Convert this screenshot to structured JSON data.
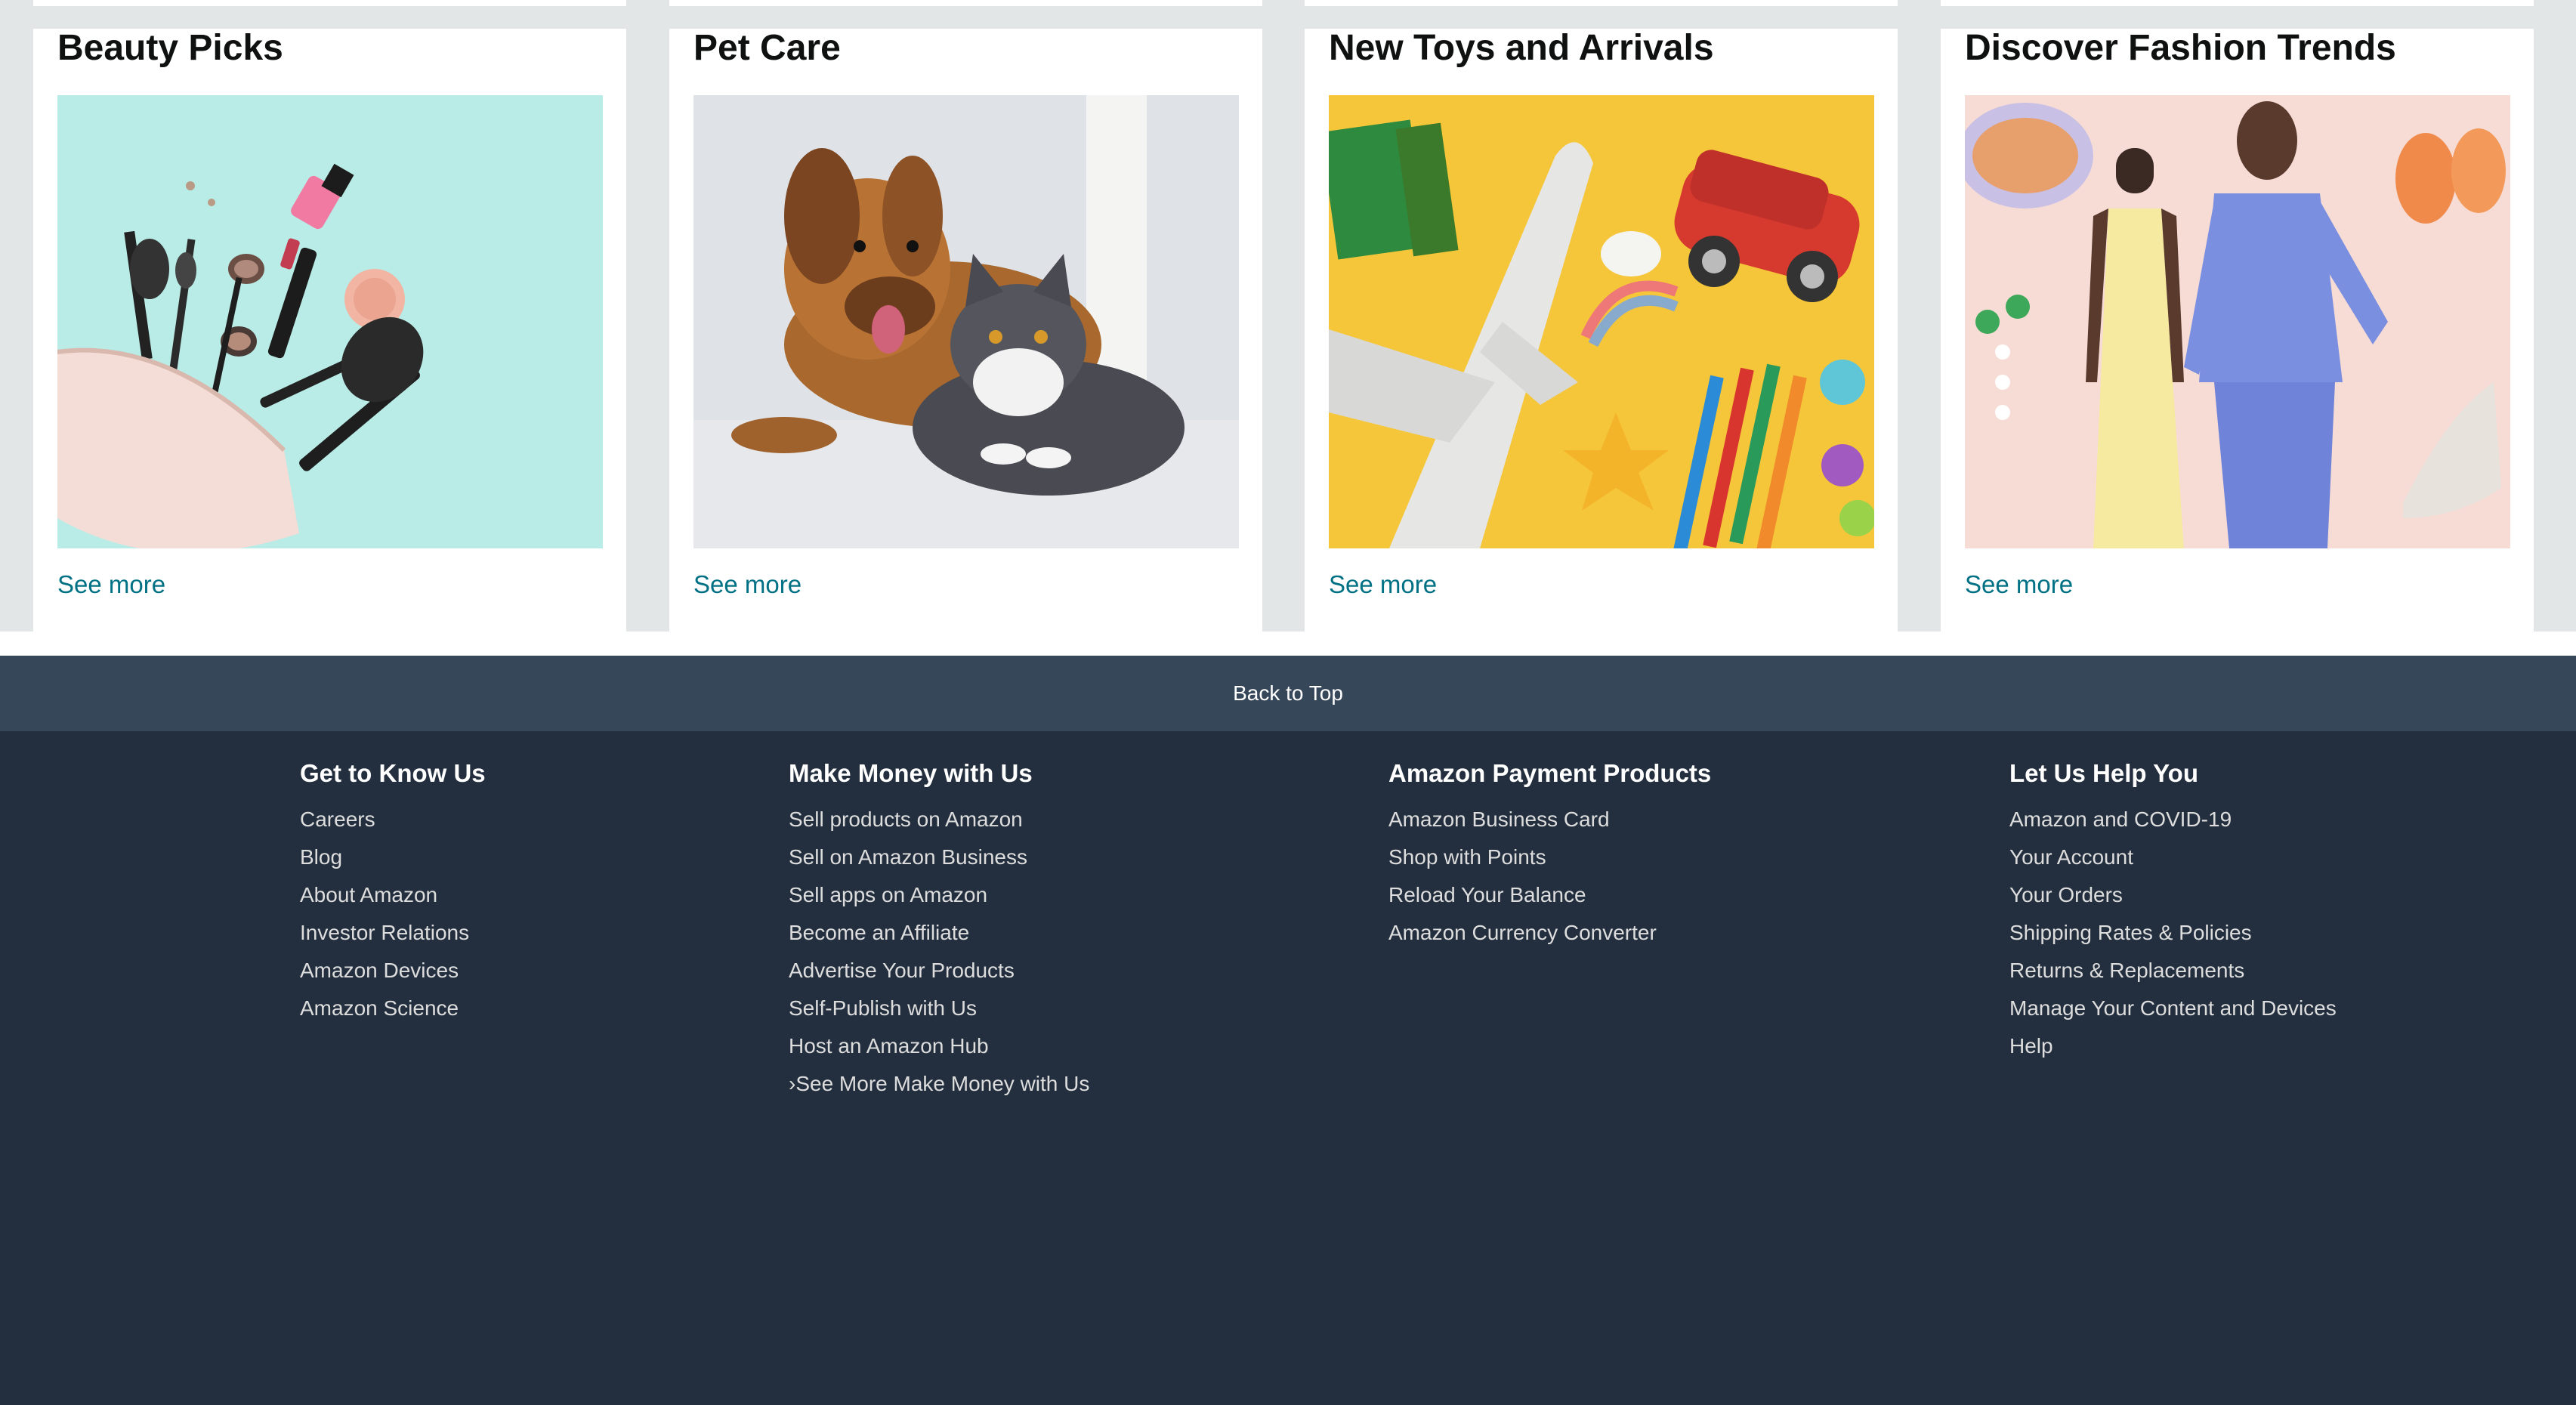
{
  "cards": [
    {
      "title": "Beauty Picks",
      "link": "See more",
      "image": "makeup-bag-image"
    },
    {
      "title": "Pet Care",
      "link": "See more",
      "image": "dog-and-cat-image"
    },
    {
      "title": "New Toys and Arrivals",
      "link": "See more",
      "image": "toys-image"
    },
    {
      "title": "Discover Fashion Trends",
      "link": "See more",
      "image": "fashion-image"
    }
  ],
  "back_to_top": "Back to Top",
  "footer": {
    "columns": [
      {
        "heading": "Get to Know Us",
        "links": [
          "Careers",
          "Blog",
          "About Amazon",
          "Investor Relations",
          "Amazon Devices",
          "Amazon Science"
        ]
      },
      {
        "heading": "Make Money with Us",
        "links": [
          "Sell products on Amazon",
          "Sell on Amazon Business",
          "Sell apps on Amazon",
          "Become an Affiliate",
          "Advertise Your Products",
          "Self-Publish with Us",
          "Host an Amazon Hub",
          "›See More Make Money with Us"
        ]
      },
      {
        "heading": "Amazon Payment Products",
        "links": [
          "Amazon Business Card",
          "Shop with Points",
          "Reload Your Balance",
          "Amazon Currency Converter"
        ]
      },
      {
        "heading": "Let Us Help You",
        "links": [
          "Amazon and COVID-19",
          "Your Account",
          "Your Orders",
          "Shipping Rates & Policies",
          "Returns & Replacements",
          "Manage Your Content and Devices",
          "Help"
        ]
      }
    ]
  },
  "colors": {
    "footer_bg": "#232f3e",
    "back_to_top_bg": "#37475a",
    "link": "#007185"
  }
}
